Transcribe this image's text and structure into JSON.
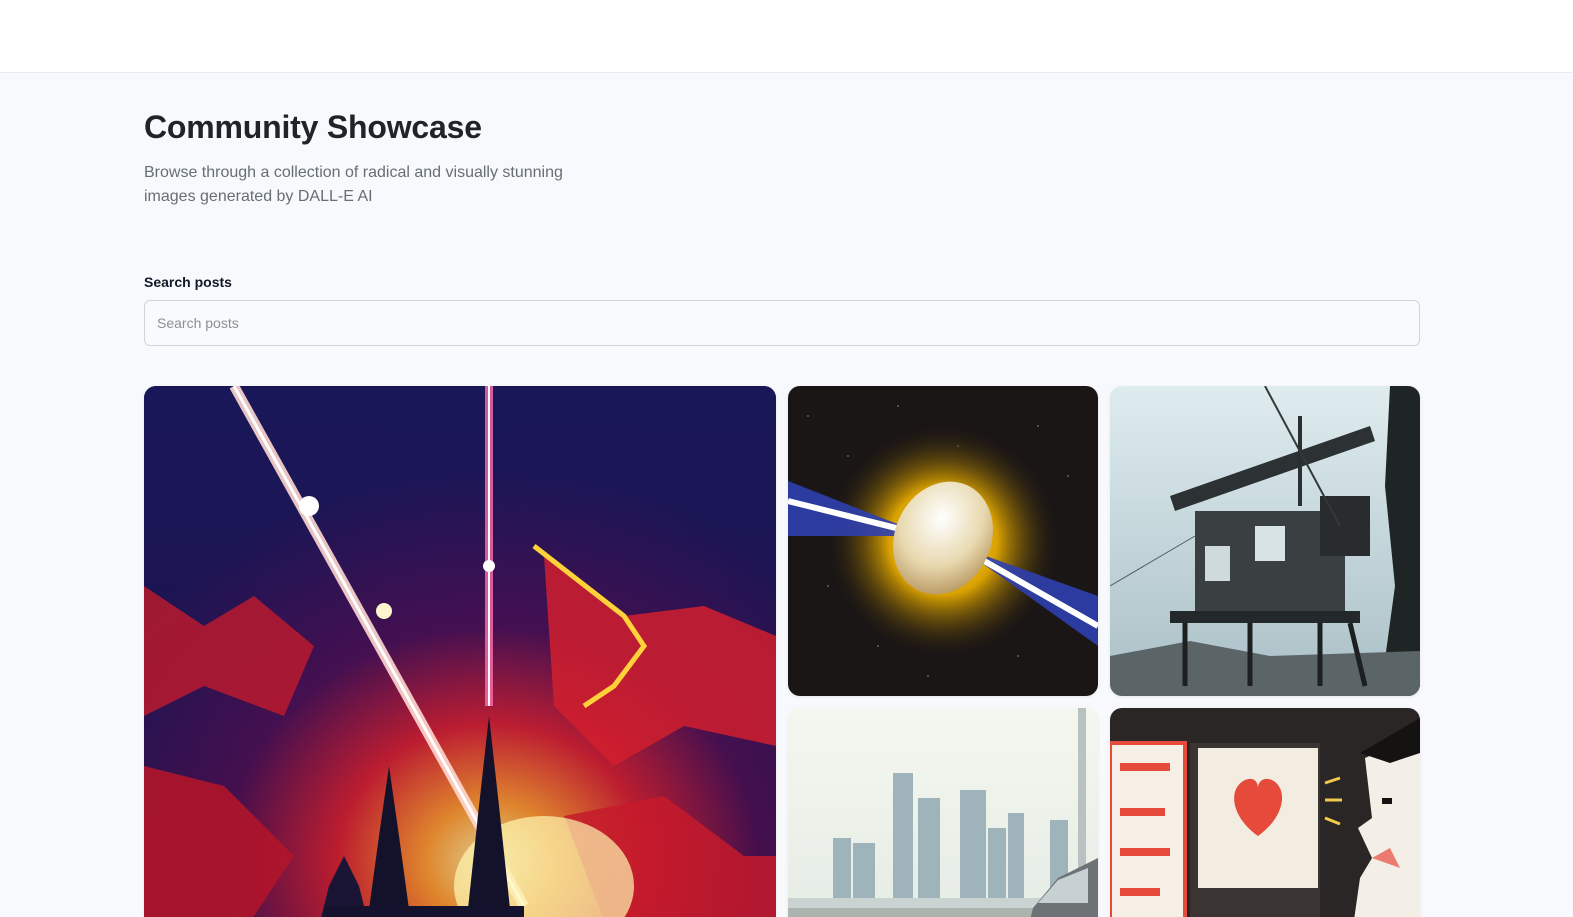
{
  "header": {
    "title": "Community Showcase",
    "subtitle": "Browse through a collection of radical and visually stunning images generated by DALL-E AI"
  },
  "search": {
    "label": "Search posts",
    "placeholder": "Search posts",
    "value": ""
  },
  "gallery": {
    "cards": [
      {
        "icon": "cathedral-laser-image"
      },
      {
        "icon": "asteroid-beam-image"
      },
      {
        "icon": "treehouse-image"
      },
      {
        "icon": "city-skyline-image"
      },
      {
        "icon": "heart-screen-image"
      }
    ]
  },
  "colors": {
    "background": "#f8f9fc",
    "title": "#222328",
    "subtitle": "#666e75",
    "input_border": "#d1d5db"
  }
}
